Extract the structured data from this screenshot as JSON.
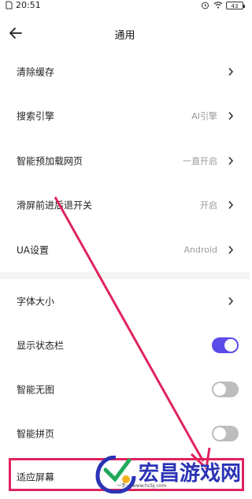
{
  "status_bar": {
    "time": "20:51",
    "battery": "43"
  },
  "header": {
    "title": "通用"
  },
  "settings": [
    {
      "label": "清除缓存",
      "value": ""
    },
    {
      "label": "搜索引擎",
      "value": "AI引擎"
    },
    {
      "label": "智能预加载网页",
      "value": "一直开启"
    },
    {
      "label": "滑屏前进后退开关",
      "value": "开启"
    },
    {
      "label": "UA设置",
      "value": "Android"
    }
  ],
  "settings2": [
    {
      "label": "字体大小"
    },
    {
      "label": "显示状态栏",
      "toggle": "on"
    },
    {
      "label": "智能无图",
      "toggle": "off"
    },
    {
      "label": "智能拼页",
      "toggle": "off"
    },
    {
      "label": "适应屏幕"
    }
  ],
  "watermark": {
    "text": "宏昌游戏网",
    "sub": "一手一 www.hcbj.com"
  },
  "colors": {
    "accent": "#5b4be8",
    "annotation": "#e0245e",
    "watermark": "#2b33b5"
  }
}
